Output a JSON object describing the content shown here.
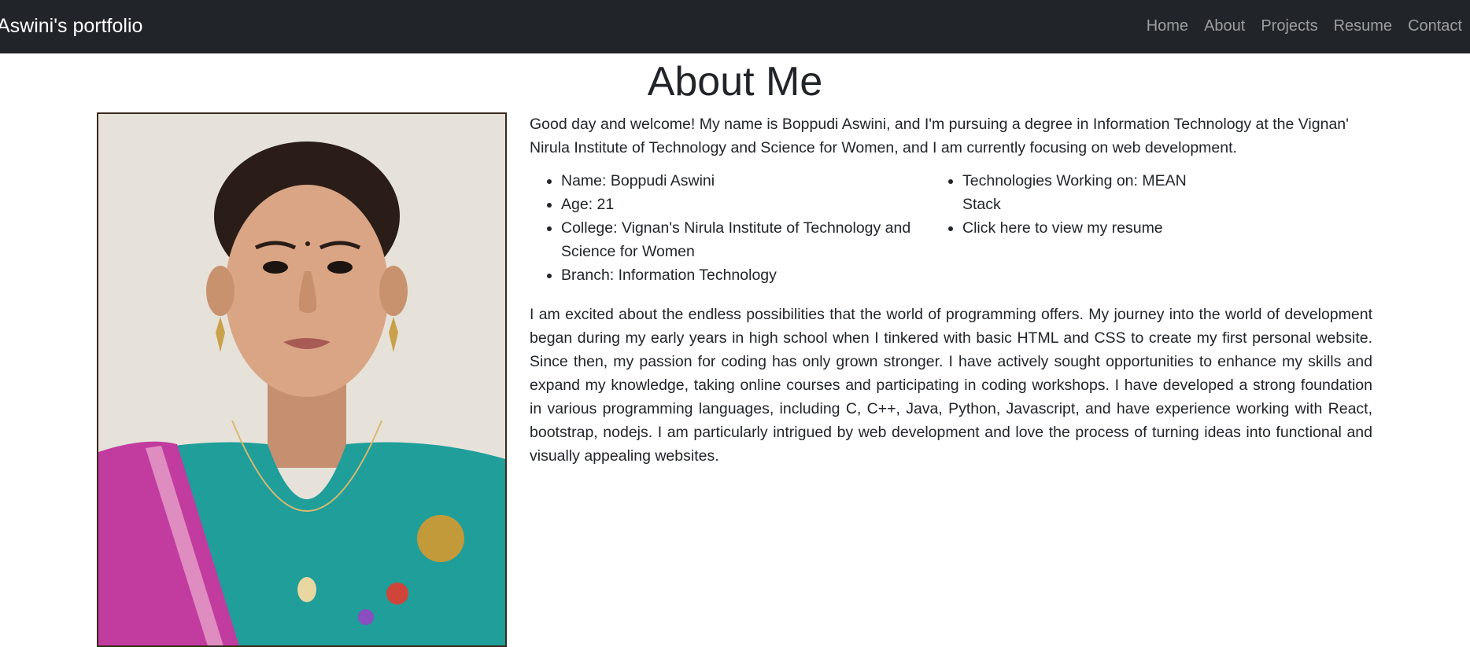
{
  "navbar": {
    "brand": "Aswini's portfolio",
    "links": [
      "Home",
      "About",
      "Projects",
      "Resume",
      "Contact"
    ]
  },
  "main": {
    "title": "About Me",
    "intro": "Good day and welcome! My name is Boppudi Aswini, and I'm pursuing a degree in Information Technology at the Vignan' Nirula Institute of Technology and Science for Women, and I am currently focusing on web development.",
    "details_left": [
      "Name: Boppudi Aswini",
      "Age: 21",
      "College: Vignan's Nirula Institute of Technology and Science for Women",
      "Branch: Information Technology"
    ],
    "details_right": {
      "technologies": "Technologies Working on: MEAN Stack",
      "resume_link": "Click here to view my resume"
    },
    "bio": "I am excited about the endless possibilities that the world of programming offers. My journey into the world of development began during my early years in high school when I tinkered with basic HTML and CSS to create my first personal website. Since then, my passion for coding has only grown stronger. I have actively sought opportunities to enhance my skills and expand my knowledge, taking online courses and participating in coding workshops. I have developed a strong foundation in various programming languages, including C, C++, Java, Python, Javascript, and have experience working with React, bootstrap, nodejs. I am particularly intrigued by web development and love the process of turning ideas into functional and visually appealing websites."
  }
}
